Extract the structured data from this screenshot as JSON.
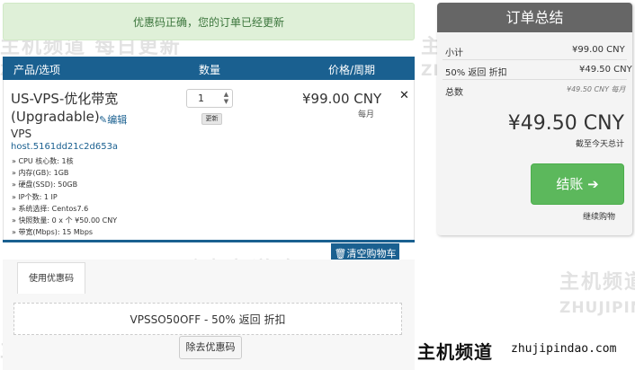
{
  "alert": {
    "message": "优惠码正确，您的订单已经更新"
  },
  "cart_header": {
    "col_product": "产品/选项",
    "col_qty": "数量",
    "col_price": "价格/周期"
  },
  "item": {
    "name_line1": "US-VPS-优化带宽",
    "name_line2": "(Upgradable)",
    "edit_label": "编辑",
    "group": "VPS",
    "hostname": "host.5161dd21c2d653a",
    "config": [
      "» CPU 核心数: 1核",
      "» 内存(GB): 1GB",
      "» 硬盘(SSD): 50GB",
      "» IP个数: 1 IP",
      "» 系统选择: Centos7.6",
      "» 快照数量: 0 x 个 ¥50.00 CNY",
      "» 带宽(Mbps): 15 Mbps"
    ],
    "quantity": "1",
    "update_label": "更新",
    "price": "¥99.00 CNY",
    "period": "每月"
  },
  "empty_cart_label": "清空购物车",
  "promo": {
    "tab_label": "使用优惠码",
    "applied_text": "VPSSO50OFF - 50% 返回 折扣",
    "remove_label": "除去优惠码"
  },
  "summary": {
    "title": "订单总结",
    "subtotal_label": "小计",
    "subtotal_value": "¥99.00 CNY",
    "discount_label": "50% 返回 折扣",
    "discount_value": "¥49.50 CNY",
    "total_label": "总数",
    "total_recurring": "¥49.50 CNY 每月",
    "total_due": "¥49.50 CNY",
    "total_due_label": "截至今天总计",
    "checkout_label": "结账",
    "continue_label": "继续购物"
  },
  "watermark": {
    "cn": "主机频道 每日更新",
    "en": "ZHUJIPINDAO.COM",
    "cn_short": "主机频道",
    "en_short": "ZHUJIPIN"
  },
  "brand": {
    "cn": "主机频道",
    "en": "zhujipindao.com"
  },
  "colors": {
    "header_blue": "#1a6090",
    "alert_green_bg": "#dff0d8",
    "checkout_green": "#5cb85c",
    "summary_head": "#666666"
  }
}
